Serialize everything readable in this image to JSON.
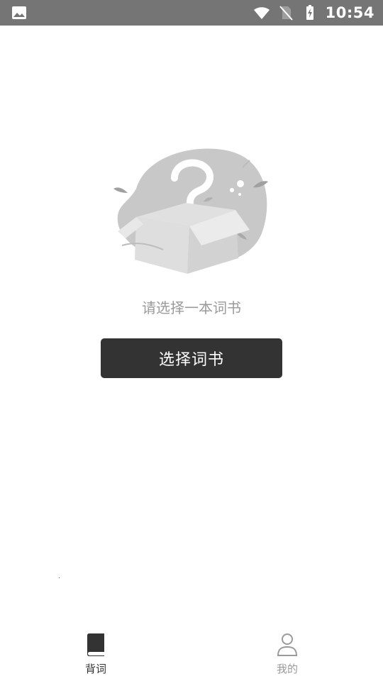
{
  "status_bar": {
    "time": "10:54",
    "icons": [
      "image-icon",
      "wifi-icon",
      "no-sim-icon",
      "battery-charging-icon"
    ]
  },
  "empty_state": {
    "illustration": "question-box-illustration",
    "message": "请选择一本词书",
    "button_label": "选择词书"
  },
  "bottom_nav": {
    "items": [
      {
        "label": "背词",
        "icon": "book-icon",
        "active": true
      },
      {
        "label": "我的",
        "icon": "person-icon",
        "active": false
      }
    ]
  },
  "colors": {
    "status_bar_bg": "#757575",
    "button_bg": "#333333",
    "text_gray": "#9a9a9a",
    "active_nav": "#333333"
  }
}
